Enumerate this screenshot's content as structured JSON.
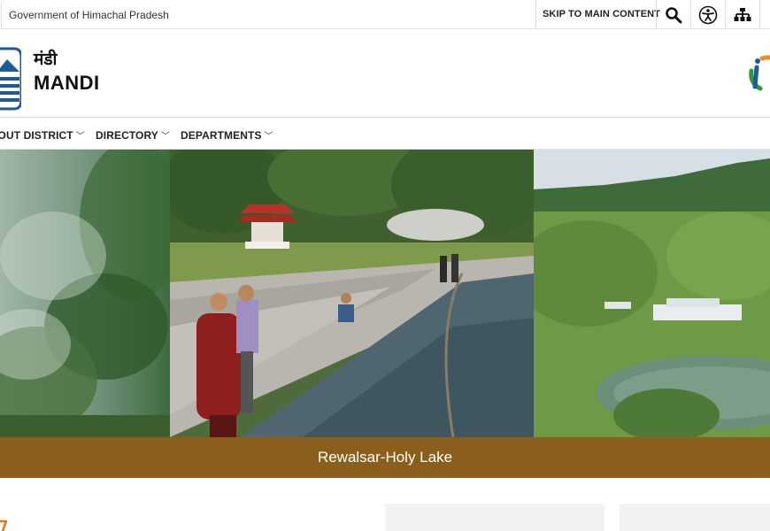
{
  "topbar": {
    "gov_label": "Government of Himachal Pradesh",
    "skip_label": "SKIP TO MAIN CONTENT",
    "icons": [
      "search-icon",
      "accessibility-icon",
      "sitemap-icon"
    ]
  },
  "header": {
    "title_hindi": "मंडी",
    "title_english": "MANDI"
  },
  "nav": {
    "items": [
      {
        "label": "ABOUT DISTRICT"
      },
      {
        "label": "DIRECTORY"
      },
      {
        "label": "DEPARTMENTS"
      }
    ],
    "chevron": "﹀"
  },
  "slider": {
    "caption": "Rewalsar-Holy Lake"
  },
  "colors": {
    "caption_bar": "#8a5f1c",
    "accent_orange": "#e8701a"
  }
}
